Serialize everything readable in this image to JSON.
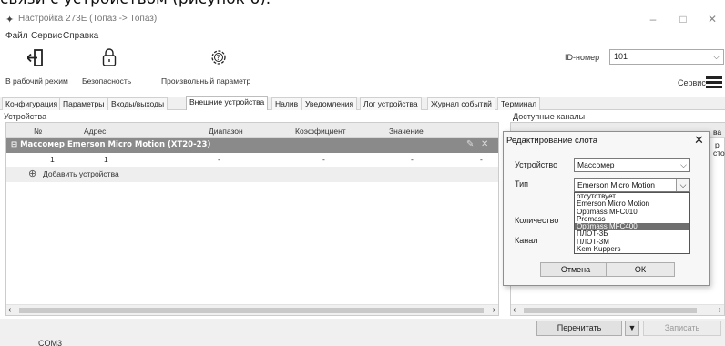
{
  "caption_fragment": "связи с устройством (рисунок 6).",
  "window": {
    "title": "Настройка 273E (Топаз -> Топаз)",
    "app_icon": "gear-icon",
    "controls": [
      "–",
      "□",
      "✕"
    ]
  },
  "menu": [
    "Файл",
    "Сервис",
    "Справка"
  ],
  "toolbar": {
    "work_mode": "В рабочий режим",
    "security": "Безопасность",
    "custom_param": "Произвольный параметр",
    "id_label": "ID-номер",
    "id_value": "101",
    "service": "Сервис"
  },
  "tabs": [
    "Конфигурация",
    "Параметры",
    "Входы/выходы",
    "Внешние устройства",
    "Налив",
    "Уведомления",
    "Лог устройства",
    "Журнал событий",
    "Терминал"
  ],
  "active_tab": "Внешние устройства",
  "devices": {
    "label": "Устройства",
    "columns": [
      "№",
      "Адрес",
      "Диапазон",
      "Коэффициент",
      "Значение"
    ],
    "group_title": "Массомер Emerson Micro Motion (XT20-23)",
    "group_toggle": "⊟",
    "rows": [
      [
        "1",
        "1",
        "-",
        "-",
        "-",
        "-"
      ]
    ],
    "add_label": "Добавить устройства"
  },
  "channels": {
    "label": "Доступные каналы",
    "header_fragment": "ва",
    "fragment_a": "р",
    "fragment_b": "сто"
  },
  "bottom": {
    "reread": "Перечитать",
    "write": "Записать"
  },
  "status": {
    "port": "COM3"
  },
  "dialog": {
    "title": "Редактирование слота",
    "device_label": "Устройство",
    "device_value": "Массомер",
    "type_label": "Тип",
    "type_value": "Emerson Micro Motion",
    "count_label": "Количество",
    "channel_label": "Канал",
    "options": [
      "отсутствует",
      "Emerson Micro Motion",
      "Optimass MFC010",
      "Promass",
      "Optimass MFC400",
      "ПЛОТ-3Б",
      "ПЛОТ-3М",
      "Kem Kuppers"
    ],
    "highlighted_option": "Optimass MFC400",
    "cancel": "Отмена",
    "ok": "ОК"
  }
}
